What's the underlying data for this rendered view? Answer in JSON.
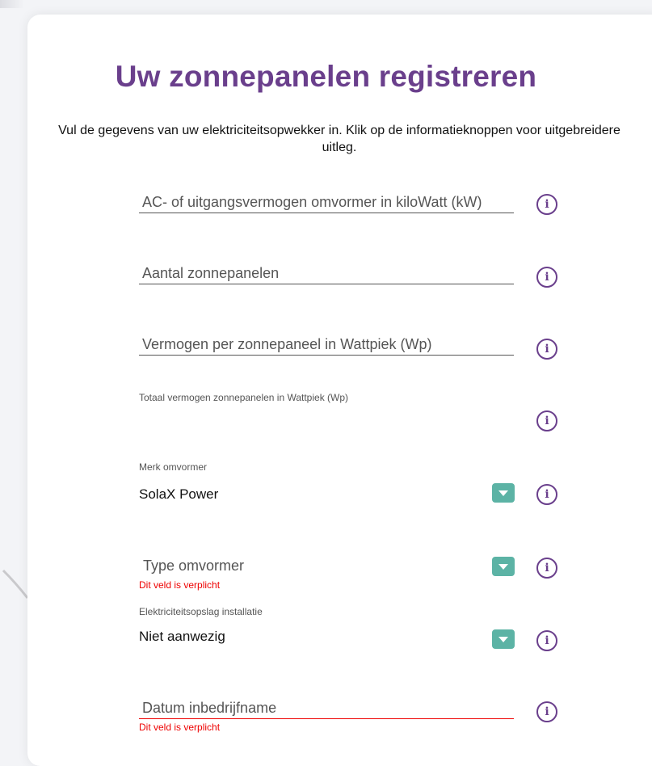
{
  "title": "Uw zonnepanelen registreren",
  "intro": "Vul de gegevens van uw elektriciteitsopwekker in. Klik op de informatieknoppen voor uitgebreidere uitleg.",
  "fields": {
    "ac_power": {
      "placeholder": "AC- of uitgangsvermogen omvormer in kiloWatt (kW)",
      "value": ""
    },
    "panel_count": {
      "placeholder": "Aantal zonnepanelen",
      "value": ""
    },
    "power_per_panel": {
      "placeholder": "Vermogen per zonnepaneel in Wattpiek (Wp)",
      "value": ""
    },
    "total_power": {
      "label": "Totaal vermogen zonnepanelen in Wattpiek (Wp)",
      "value": ""
    },
    "inverter_brand": {
      "label": "Merk omvormer",
      "value": "SolaX Power"
    },
    "inverter_type": {
      "placeholder": "Type omvormer",
      "error": "Dit veld is verplicht"
    },
    "storage": {
      "label": "Elektriciteitsopslag installatie",
      "value": "Niet aanwezig"
    },
    "commission_date": {
      "placeholder": "Datum inbedrijfname",
      "error": "Dit veld is verplicht"
    }
  },
  "info_icon": "info-icon",
  "dropdown_icon": "chevron-down-icon",
  "colors": {
    "title": "#6a3f8c",
    "info_icon": "#6a3f8c",
    "dropdown_button": "#5cb3a5",
    "error": "#e00000"
  }
}
